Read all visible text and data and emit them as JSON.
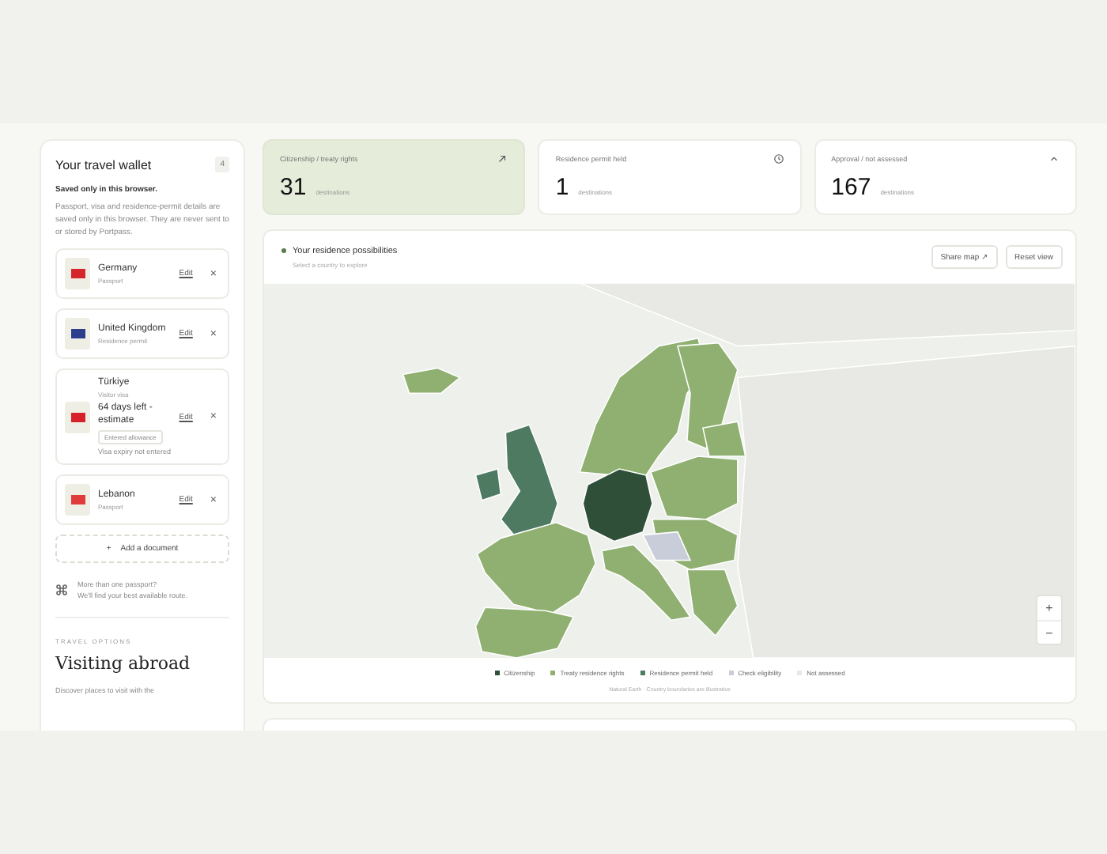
{
  "wallet": {
    "title": "Your travel wallet",
    "count": "4",
    "notice_title": "Saved only in this browser.",
    "notice_body": "Passport, visa and residence-permit details are saved only in this browser. They are never sent to or stored by Portpass.",
    "documents": [
      {
        "country": "Germany",
        "type": "Passport",
        "color": "#d4262b",
        "edit": "Edit",
        "remove": "×"
      },
      {
        "country": "United Kingdom",
        "type": "Residence permit",
        "color": "#2b3e8c",
        "edit": "Edit",
        "remove": "×"
      },
      {
        "country": "Türkiye",
        "type": "Visitor visa",
        "color": "#d8202a",
        "status": "64 days left - estimate",
        "tag": "Entered allowance",
        "note": "Visa expiry not entered",
        "edit": "Edit",
        "remove": "×"
      },
      {
        "country": "Lebanon",
        "type": "Passport",
        "color": "#e03a3a",
        "edit": "Edit",
        "remove": "×"
      }
    ],
    "add_button": "Add a document",
    "add_icon": "+",
    "tip_line1": "More than one passport?",
    "tip_line2": "We'll find your best available route.",
    "section_label": "TRAVEL OPTIONS",
    "section_title": "Visiting abroad",
    "section_body": "Discover places to visit with the"
  },
  "stats": [
    {
      "label": "Citizenship / treaty rights",
      "value": "31",
      "unit": "destinations",
      "selected": true,
      "kind": "arrow"
    },
    {
      "label": "Residence permit held",
      "value": "1",
      "unit": "destinations",
      "selected": false,
      "kind": "clock"
    },
    {
      "label": "Approval / not assessed",
      "value": "167",
      "unit": "destinations",
      "selected": false,
      "kind": "chevron"
    }
  ],
  "map": {
    "title": "Your residence possibilities",
    "subtitle": "Select a country to explore",
    "share": "Share map ↗",
    "reset": "Reset view",
    "zoom_in": "+",
    "zoom_out": "−",
    "legend": [
      {
        "label": "Citizenship",
        "color": "#2f4f38"
      },
      {
        "label": "Treaty residence rights",
        "color": "#8fb070"
      },
      {
        "label": "Residence permit held",
        "color": "#4f7a62"
      },
      {
        "label": "Check eligibility",
        "color": "#c9cdd9"
      },
      {
        "label": "Not assessed",
        "color": "#e8e9e4"
      }
    ],
    "credit": "Natural Earth · Country boundaries are illustrative"
  }
}
